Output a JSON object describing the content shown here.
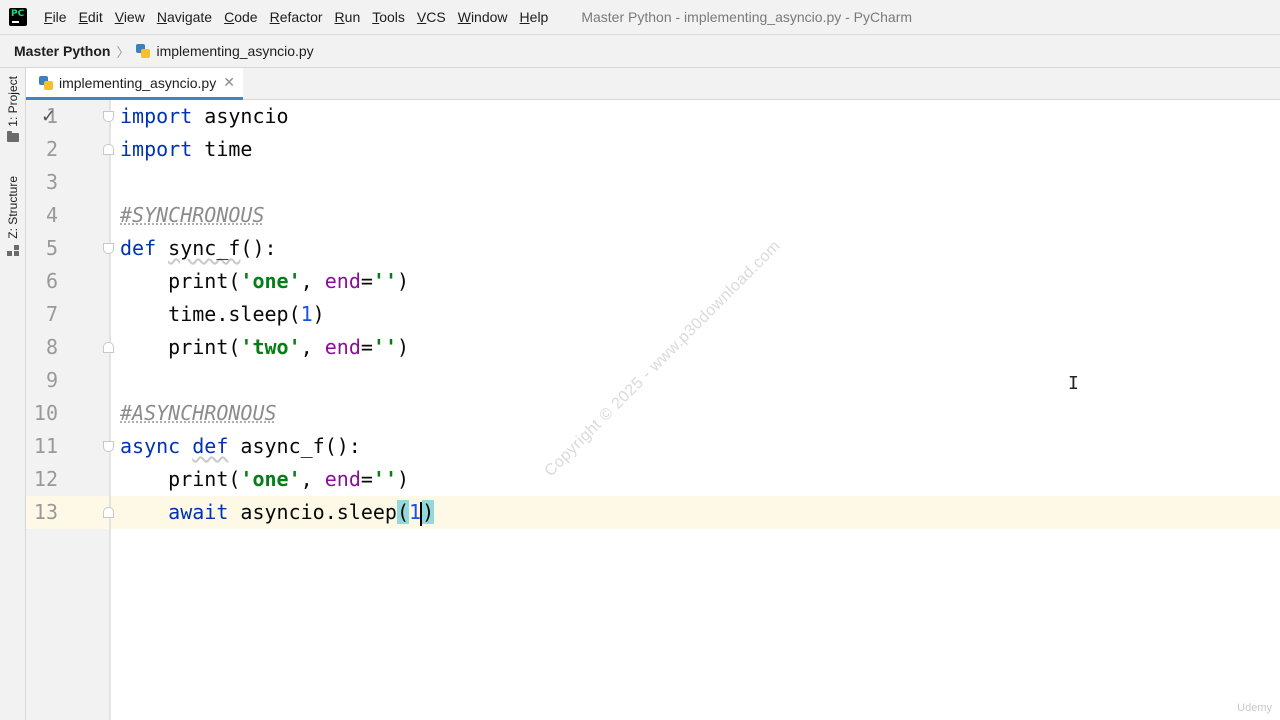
{
  "menubar": {
    "items": [
      {
        "label": "File",
        "mnemonic": "F",
        "rest": "ile"
      },
      {
        "label": "Edit",
        "mnemonic": "E",
        "rest": "dit"
      },
      {
        "label": "View",
        "mnemonic": "V",
        "rest": "iew"
      },
      {
        "label": "Navigate",
        "mnemonic": "N",
        "rest": "avigate"
      },
      {
        "label": "Code",
        "mnemonic": "C",
        "rest": "ode"
      },
      {
        "label": "Refactor",
        "mnemonic": "R",
        "rest": "efactor"
      },
      {
        "label": "Run",
        "mnemonic": "R",
        "rest": "un"
      },
      {
        "label": "Tools",
        "mnemonic": "T",
        "rest": "ools"
      },
      {
        "label": "VCS",
        "mnemonic": "V",
        "rest": "CS"
      },
      {
        "label": "Window",
        "mnemonic": "W",
        "rest": "indow"
      },
      {
        "label": "Help",
        "mnemonic": "H",
        "rest": "elp"
      }
    ],
    "window_title": "Master Python - implementing_asyncio.py - PyCharm",
    "logo_text": "PC"
  },
  "navbar": {
    "project": "Master Python",
    "separator": "〉",
    "file": "implementing_asyncio.py"
  },
  "toolstrip": {
    "project_label": "1: Project",
    "structure_label": "Z: Structure"
  },
  "tab": {
    "label": "implementing_asyncio.py",
    "close": "✕"
  },
  "editor": {
    "line_numbers": [
      "1",
      "2",
      "3",
      "4",
      "5",
      "6",
      "7",
      "8",
      "9",
      "10",
      "11",
      "12",
      "13"
    ],
    "check_mark": "✓",
    "lines": [
      [
        {
          "t": "import",
          "c": "kw"
        },
        {
          "t": " asyncio",
          "c": ""
        }
      ],
      [
        {
          "t": "import",
          "c": "kw"
        },
        {
          "t": " time",
          "c": ""
        }
      ],
      [],
      [
        {
          "t": "#SYNCHRONOUS",
          "c": "cmt"
        }
      ],
      [
        {
          "t": "def",
          "c": "kw"
        },
        {
          "t": " ",
          "c": ""
        },
        {
          "t": "sync_f",
          "c": "wavy"
        },
        {
          "t": "():",
          "c": ""
        }
      ],
      [
        {
          "t": "    print(",
          "c": ""
        },
        {
          "t": "'one'",
          "c": "str"
        },
        {
          "t": ", ",
          "c": ""
        },
        {
          "t": "end",
          "c": "param"
        },
        {
          "t": "=",
          "c": ""
        },
        {
          "t": "''",
          "c": "str"
        },
        {
          "t": ")",
          "c": ""
        }
      ],
      [
        {
          "t": "    time.sleep(",
          "c": ""
        },
        {
          "t": "1",
          "c": "num"
        },
        {
          "t": ")",
          "c": ""
        }
      ],
      [
        {
          "t": "    print(",
          "c": ""
        },
        {
          "t": "'two'",
          "c": "str"
        },
        {
          "t": ", ",
          "c": ""
        },
        {
          "t": "end",
          "c": "param"
        },
        {
          "t": "=",
          "c": ""
        },
        {
          "t": "''",
          "c": "str"
        },
        {
          "t": ")",
          "c": ""
        }
      ],
      [],
      [
        {
          "t": "#ASYNCHRONOUS",
          "c": "cmt"
        }
      ],
      [
        {
          "t": "async",
          "c": "kw"
        },
        {
          "t": " ",
          "c": ""
        },
        {
          "t": "def",
          "c": "kw wavy"
        },
        {
          "t": " async_f():",
          "c": ""
        }
      ],
      [
        {
          "t": "    print(",
          "c": ""
        },
        {
          "t": "'one'",
          "c": "str"
        },
        {
          "t": ", ",
          "c": ""
        },
        {
          "t": "end",
          "c": "param"
        },
        {
          "t": "=",
          "c": ""
        },
        {
          "t": "''",
          "c": "str"
        },
        {
          "t": ")",
          "c": ""
        }
      ],
      [
        {
          "t": "    ",
          "c": ""
        },
        {
          "t": "await",
          "c": "kw"
        },
        {
          "t": " asyncio.sleep",
          "c": ""
        },
        {
          "t": "(",
          "c": "brace-hl"
        },
        {
          "t": "1",
          "c": "num"
        },
        {
          "t": "CARET",
          "c": "caret"
        },
        {
          "t": ")",
          "c": "brace-hl"
        }
      ]
    ]
  },
  "watermark": "Copyright © 2025 - www.p30download.com",
  "badge": "Udemy",
  "colors": {
    "accent": "#4083c9",
    "keyword": "#0033b3",
    "string": "#067d17",
    "number": "#1750eb",
    "param": "#871094",
    "comment": "#8c8c8c"
  }
}
